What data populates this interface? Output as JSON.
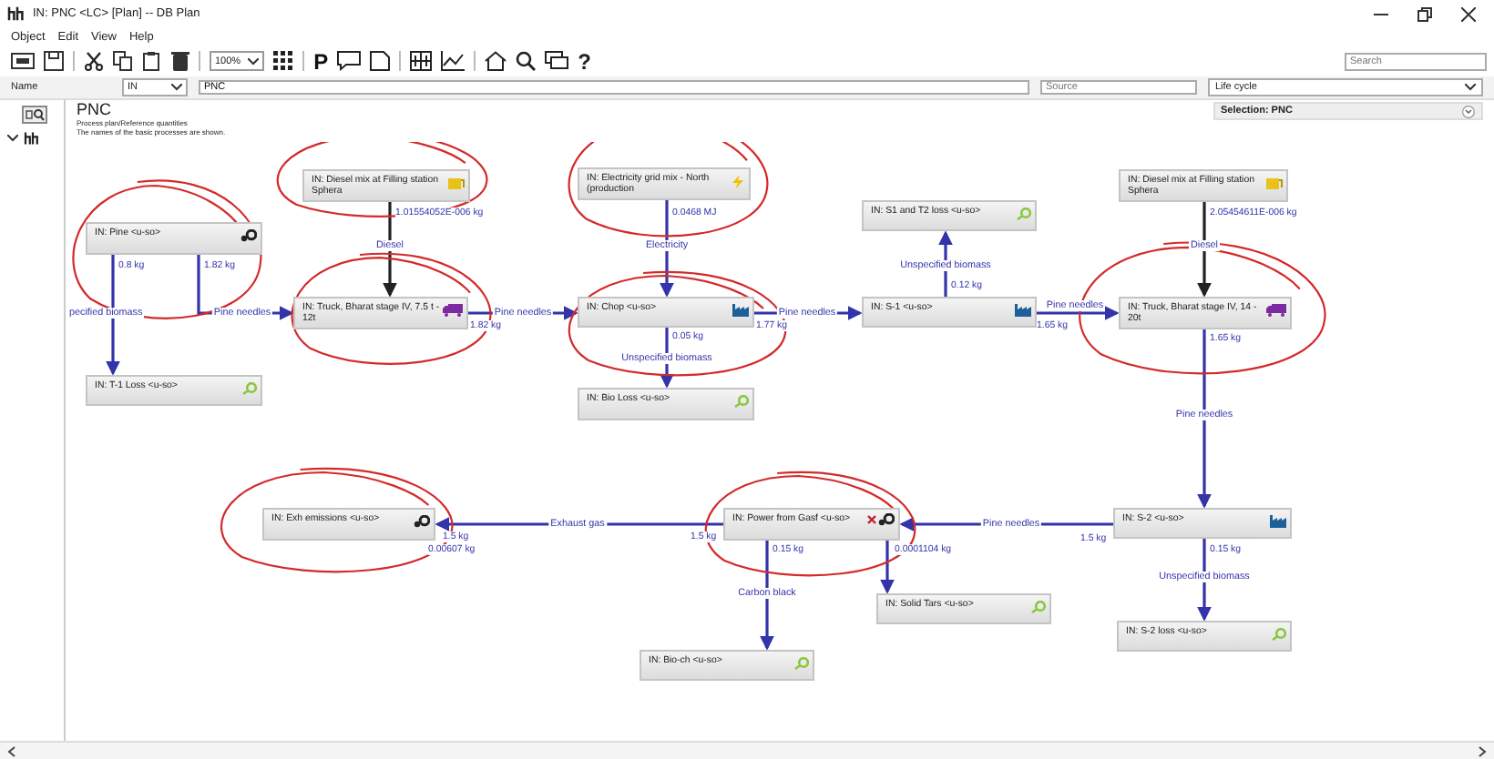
{
  "window": {
    "title": "IN: PNC <LC> [Plan] -- DB Plan"
  },
  "menu": [
    "Object",
    "Edit",
    "View",
    "Help"
  ],
  "toolbar": {
    "zoom": "100%",
    "letter_button": "P",
    "help_button": "?",
    "search_placeholder": "Search"
  },
  "name_row": {
    "label": "Name",
    "prefix": "IN",
    "name": "PNC",
    "source_placeholder": "Source",
    "type": "Life cycle"
  },
  "panel": {
    "title": "PNC",
    "lines": [
      "Process plan/Reference quantities",
      "The names of the basic processes are shown."
    ],
    "selection": "Selection: PNC"
  },
  "nodes": [
    {
      "label": "IN: Diesel mix at Filling station Sphera"
    },
    {
      "label": "IN: Electricity grid mix - North (production"
    },
    {
      "label": "IN: Diesel mix at Filling station Sphera"
    },
    {
      "label": "IN: S1 and T2 loss <u-so>"
    },
    {
      "label": "IN: Pine <u-so>"
    },
    {
      "label": "IN: Truck, Bharat stage IV, 7.5 t - 12t"
    },
    {
      "label": "IN: Chop <u-so>"
    },
    {
      "label": "IN: S-1 <u-so>"
    },
    {
      "label": "IN: Truck, Bharat stage IV, 14 - 20t"
    },
    {
      "label": "IN: T-1 Loss <u-so>"
    },
    {
      "label": "IN: Bio Loss <u-so>"
    },
    {
      "label": "IN: Exh emissions <u-so>"
    },
    {
      "label": "IN: Power from Gasf <u-so>"
    },
    {
      "label": "IN: S-2 <u-so>"
    },
    {
      "label": "IN: Solid Tars <u-so>"
    },
    {
      "label": "IN: S-2 loss <u-so>"
    },
    {
      "label": "IN: Bio-ch <u-so>"
    }
  ],
  "flows": [
    {
      "name": "Diesel",
      "amounts": [
        "1.01554052E-006 kg"
      ]
    },
    {
      "name": "Electricity",
      "amounts": [
        "0.0468 MJ"
      ]
    },
    {
      "name": "Diesel",
      "amounts": [
        "2.05454611E-006 kg"
      ]
    },
    {
      "name": "pecified biomass",
      "amounts": [
        "0.8 kg"
      ]
    },
    {
      "name": "Pine needles",
      "amounts": [
        "1.82 kg"
      ]
    },
    {
      "name": "Pine needles",
      "amounts": [
        "1.82 kg"
      ]
    },
    {
      "name": "Pine needles",
      "amounts": [
        "1.77 kg"
      ]
    },
    {
      "name": "Unspecified biomass",
      "amounts": [
        "0.05 kg"
      ]
    },
    {
      "name": "Unspecified biomass",
      "amounts": [
        "0.12 kg"
      ]
    },
    {
      "name": "Pine needles",
      "amounts": [
        "1.65 kg"
      ]
    },
    {
      "name": "Pine needles",
      "amounts": [
        "1.65 kg"
      ]
    },
    {
      "name": "Pine needles",
      "amounts": [
        "1.5 kg"
      ]
    },
    {
      "name": "Unspecified biomass",
      "amounts": [
        "0.15 kg"
      ]
    },
    {
      "name": "Exhaust gas",
      "amounts": [
        "1.5 kg",
        "1.5 kg",
        "0.00607 kg"
      ]
    },
    {
      "name": "Carbon black",
      "amounts": [
        "0.15 kg"
      ]
    },
    {
      "amounts": [
        "0.0001104 kg"
      ]
    }
  ]
}
